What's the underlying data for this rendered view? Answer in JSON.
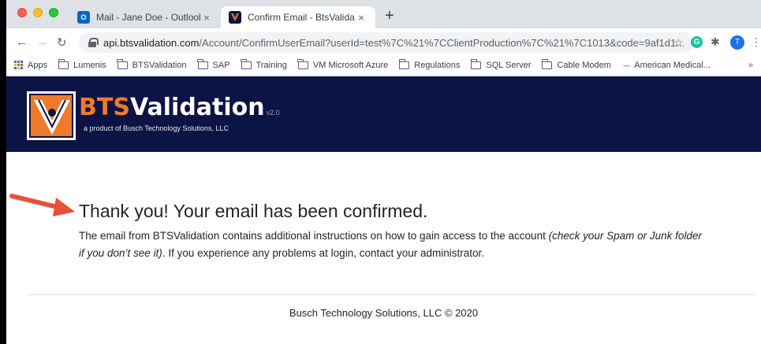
{
  "browser": {
    "tabs": [
      {
        "title": "Mail - Jane Doe - Outlook",
        "icon": "outlook-icon",
        "close": "×"
      },
      {
        "title": "Confirm Email - BtsValidation",
        "icon": "btsvalidation-icon",
        "close": "×"
      }
    ],
    "new_tab": "+",
    "url_host": "api.btsvalidation.com",
    "url_path": "/Account/ConfirmUserEmail?userId=test%7C%21%7CClientProduction%7C%21%7C1013&code=9af1d1...",
    "avatar_initial": "T",
    "grammarly_letter": "G",
    "bookmarks": [
      {
        "label": "Apps",
        "icon": "apps-grid-icon"
      },
      {
        "label": "Lumenis",
        "icon": "folder-icon"
      },
      {
        "label": "BTSValidation",
        "icon": "folder-icon"
      },
      {
        "label": "SAP",
        "icon": "folder-icon"
      },
      {
        "label": "Training",
        "icon": "folder-icon"
      },
      {
        "label": "VM Microsoft Azure",
        "icon": "folder-icon"
      },
      {
        "label": "Regulations",
        "icon": "folder-icon"
      },
      {
        "label": "SQL Server",
        "icon": "folder-icon"
      },
      {
        "label": "Cable Modem",
        "icon": "folder-icon"
      },
      {
        "label": "American Medical...",
        "icon": "ama-icon"
      }
    ],
    "bookmarks_more": "»"
  },
  "site": {
    "brand_prefix": "BTS",
    "brand_suffix": "Validation",
    "version": "v2.0",
    "tagline": "a product of Busch Technology Solutions, LLC",
    "header_color": "#0c1445",
    "accent_color": "#f07a2a"
  },
  "content": {
    "headline": "Thank you! Your email has been confirmed.",
    "body_part1": "The email from BTSValidation contains additional instructions on how to gain access to the account ",
    "body_italic": "(check your Spam or Junk folder if you don’t see it)",
    "body_part2": ". If you experience any problems at login, contact your administrator.",
    "arrow_color": "#e8503a"
  },
  "footer": {
    "text": "Busch Technology Solutions, LLC © 2020"
  }
}
